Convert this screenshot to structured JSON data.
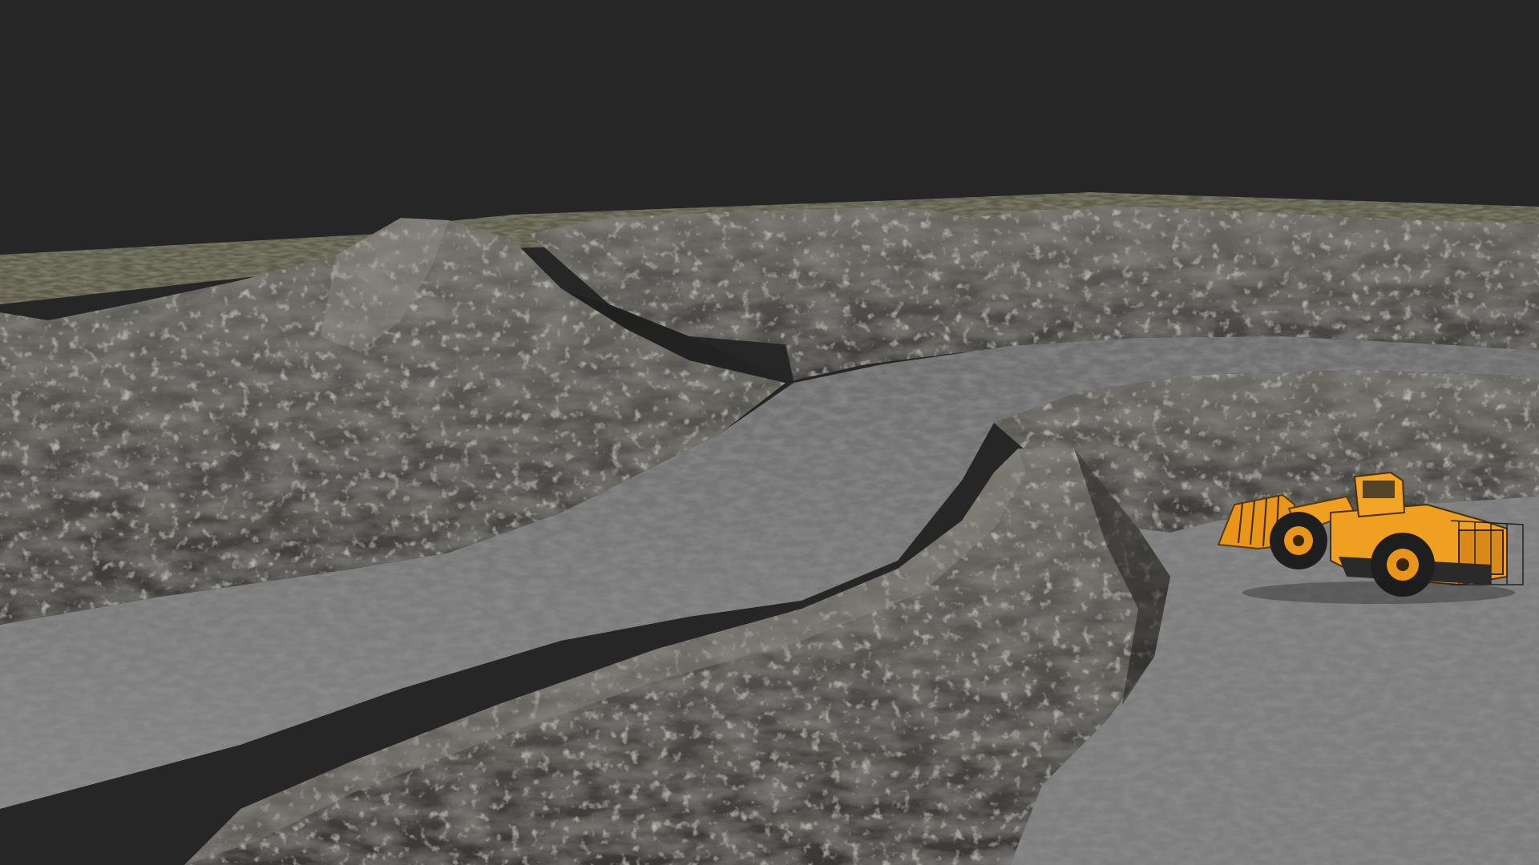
{
  "scene": {
    "kind": "3d-viewport",
    "subject": "open-pit-mine-terrain",
    "background_color": "#262626",
    "rock_color": "#5a5854",
    "road_color": "#7a7a7a",
    "grass_color": "#5f5a45",
    "vehicle": {
      "type": "wheel-loader",
      "color": "#f0a020"
    }
  }
}
